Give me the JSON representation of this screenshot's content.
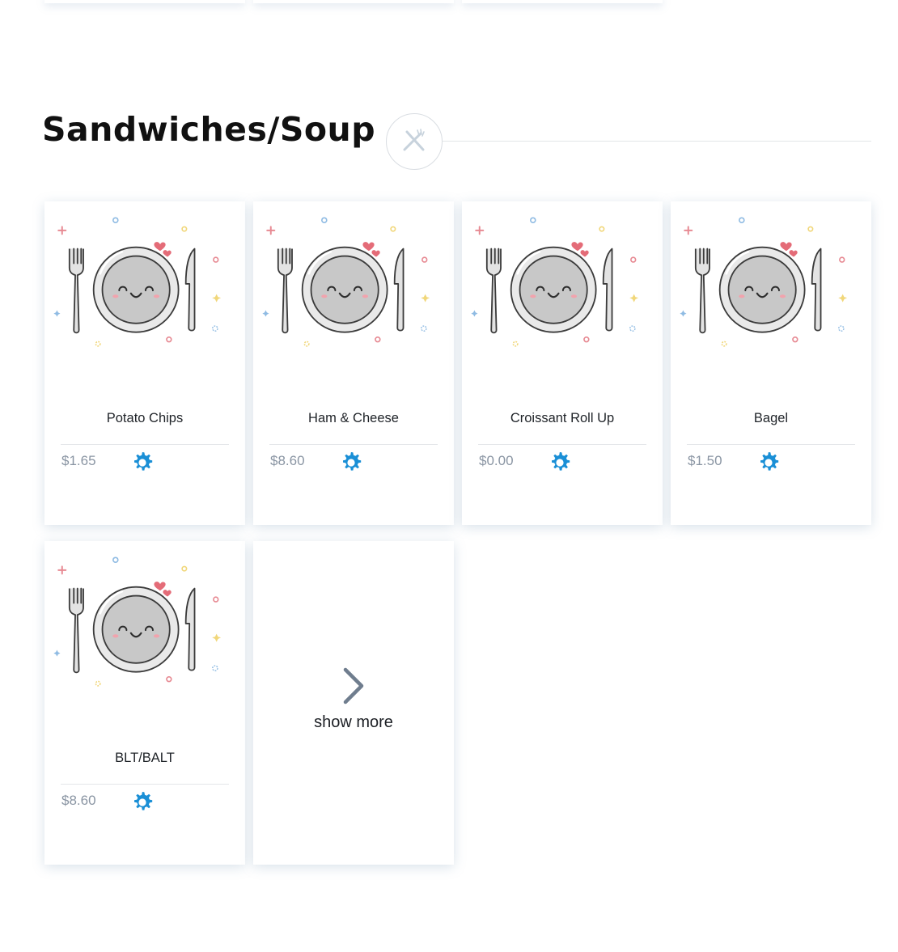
{
  "section": {
    "title": "Sandwiches/Soup",
    "icon": "fork-knife-icon"
  },
  "products": [
    {
      "name": "Potato Chips",
      "price": "$1.65"
    },
    {
      "name": "Ham & Cheese",
      "price": "$8.60"
    },
    {
      "name": "Croissant Roll Up",
      "price": "$0.00"
    },
    {
      "name": "Bagel",
      "price": "$1.50"
    },
    {
      "name": "BLT/BALT",
      "price": "$8.60"
    }
  ],
  "show_more": {
    "label": "show more",
    "icon": "chevron-right-icon"
  },
  "colors": {
    "accent": "#1a8fd6",
    "price": "#8a95a3",
    "chevron": "#6f7d8e"
  }
}
